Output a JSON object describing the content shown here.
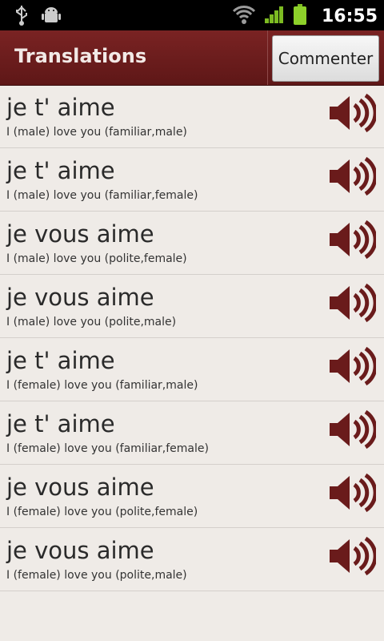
{
  "status_bar": {
    "time": "16:55",
    "icons": [
      "usb-icon",
      "android-debug-icon",
      "wifi-icon",
      "signal-icon",
      "battery-icon"
    ]
  },
  "header": {
    "title": "Translations",
    "comment_button": "Commenter"
  },
  "colors": {
    "header": "#6a1b1b",
    "background": "#efebe7",
    "speaker": "#6a1b1b"
  },
  "translations": [
    {
      "phrase": "je t' aime",
      "meaning": "I (male) love you (familiar,male)"
    },
    {
      "phrase": "je t' aime",
      "meaning": "I (male) love you (familiar,female)"
    },
    {
      "phrase": "je vous aime",
      "meaning": "I (male) love you (polite,female)"
    },
    {
      "phrase": "je vous aime",
      "meaning": "I (male) love you (polite,male)"
    },
    {
      "phrase": "je t' aime",
      "meaning": "I (female) love you (familiar,male)"
    },
    {
      "phrase": "je t' aime",
      "meaning": "I (female) love you (familiar,female)"
    },
    {
      "phrase": "je vous aime",
      "meaning": "I (female) love you (polite,female)"
    },
    {
      "phrase": "je vous aime",
      "meaning": "I (female) love you (polite,male)"
    }
  ]
}
